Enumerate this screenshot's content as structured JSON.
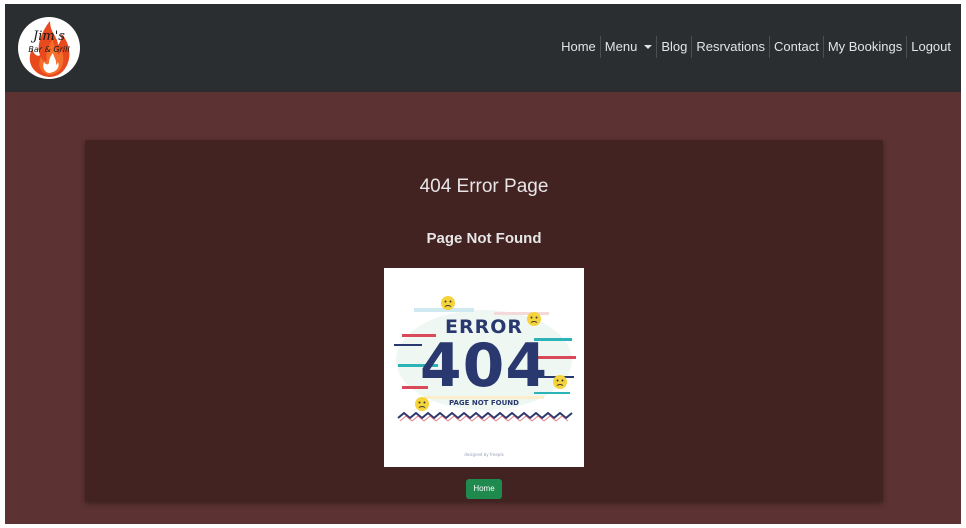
{
  "brand": {
    "logo_line1": "Jim's",
    "logo_line2": "Bar & Grill",
    "flame_color": "#e8491d"
  },
  "nav": {
    "items": [
      {
        "label": "Home"
      },
      {
        "label": "Menu",
        "has_dropdown": true
      },
      {
        "label": "Blog"
      },
      {
        "label": "Resrvations"
      },
      {
        "label": "Contact"
      },
      {
        "label": "My Bookings"
      },
      {
        "label": "Logout"
      }
    ]
  },
  "main": {
    "title": "404 Error Page",
    "subtitle": "Page Not Found",
    "image": {
      "error_word": "ERROR",
      "code": "404",
      "caption": "PAGE NOT FOUND",
      "credit": "designed by freepik"
    },
    "home_button": "Home"
  },
  "colors": {
    "navbar": "#2b2e31",
    "page_bg": "#5c3232",
    "card_bg": "#432222",
    "button": "#1e8a4e",
    "error_text": "#29386e"
  }
}
